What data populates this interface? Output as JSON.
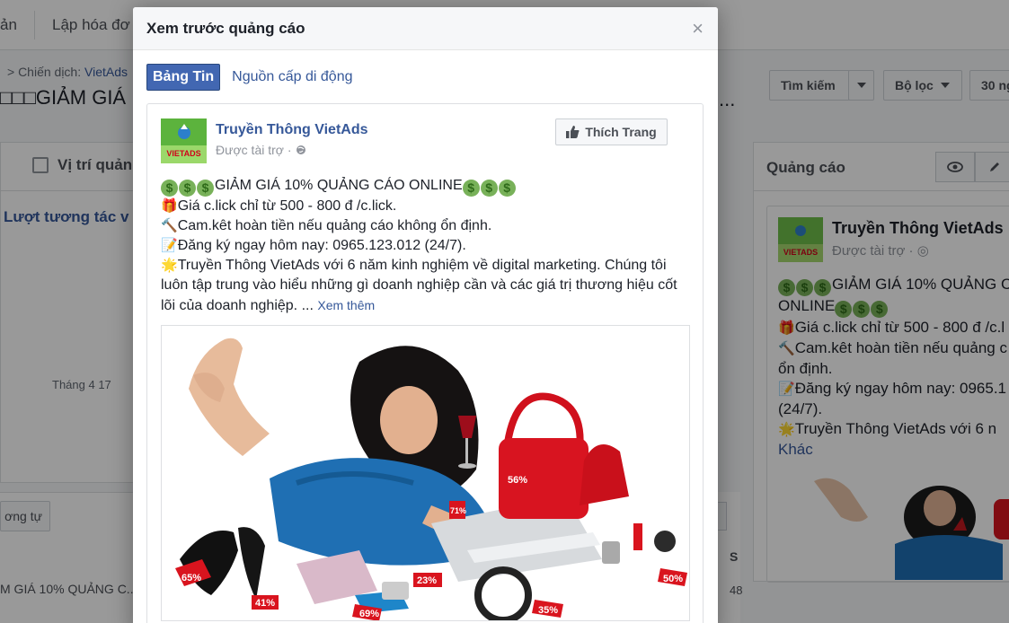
{
  "background": {
    "topbar": {
      "item1": "ản",
      "item2": "Lập hóa đơ"
    },
    "breadcrumb": {
      "prefix": "> Chiến dịch: ",
      "link": "VietAds"
    },
    "campaign_title": "□□□GIẢM GIÁ",
    "ellipsis": "...",
    "toolbar": {
      "search": "Tìm kiếm",
      "filter": "Bộ lọc",
      "date": "30 ng"
    },
    "left_panel": {
      "position_label": "Vị trí quản",
      "metric": "Lượt tương tác v",
      "axis_label": "Tháng 4 17"
    },
    "similar_button": "ơng tự",
    "table_row": "M GIÁ 10% QUẢNG C...",
    "col_s": "S",
    "col_value": "48",
    "right_panel": {
      "title": "Quảng cáo",
      "page_name": "Truyền Thông VietAds",
      "sponsored": "Được tài trợ",
      "line1": "GIẢM GIÁ 10% QUẢNG C",
      "line1b": "ONLINE",
      "line2": "Giá c.lick chỉ từ 500 - 800 đ /c.l",
      "line3": "Cam.kêt hoàn tiền nếu quảng c",
      "line3b": "ổn định.",
      "line4": "Đăng ký ngay hôm nay: 0965.1",
      "line4b": "(24/7).",
      "line5": "Truyền Thông VietAds với 6 n",
      "more": "Khác"
    }
  },
  "modal": {
    "title": "Xem trước quảng cáo",
    "close": "×",
    "tabs": [
      {
        "label": "Bảng Tin",
        "active": true
      },
      {
        "label": "Nguồn cấp di động",
        "active": false
      }
    ],
    "post": {
      "logo_text": "VIETADS",
      "page_name": "Truyền Thông VietAds",
      "sponsored": "Được tài trợ · ",
      "like_button": "Thích Trang",
      "line1": "GIẢM GIÁ 10% QUẢNG CÁO ONLINE",
      "line2": "Giá c.lick chỉ từ 500 - 800 đ /c.lick.",
      "line3": "Cam.kêt hoàn tiền nếu quảng cáo không ổn định.",
      "line4": "Đăng ký ngay hôm nay: 0965.123.012 (24/7).",
      "line5": "Truyền Thông VietAds với 6 năm kinh nghiệm về digital marketing. Chúng tôi luôn tập trung vào hiểu những gì doanh nghiệp cần và các giá trị thương hiệu cốt lõi của doanh nghiệp. ... ",
      "see_more": "Xem thêm",
      "image_labels": {
        "tag1": "56%",
        "tag2": "65%",
        "tag3": "41%",
        "tag4": "23%",
        "tag5": "69%",
        "tag6": "50%",
        "tag7": "35%",
        "tag8": "71%"
      }
    }
  },
  "colors": {
    "fb_blue": "#4267b2",
    "link_blue": "#365899",
    "overlay": "rgba(0,0,0,0.4)"
  }
}
